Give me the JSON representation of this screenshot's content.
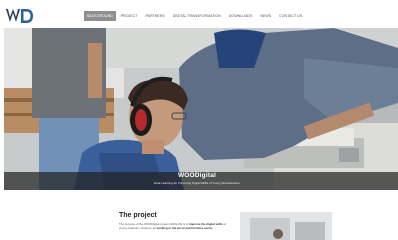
{
  "brand": {
    "logo_text": "WD",
    "logo_tagline": "WOODigital"
  },
  "nav": {
    "items": [
      {
        "label": "Background",
        "active": true
      },
      {
        "label": "Project",
        "active": false
      },
      {
        "label": "Partners",
        "active": false
      },
      {
        "label": "Digital Transformation",
        "active": false
      },
      {
        "label": "Downloads",
        "active": false
      },
      {
        "label": "News",
        "active": false
      },
      {
        "label": "Contact us",
        "active": false
      }
    ]
  },
  "hero": {
    "title": "WOODigital",
    "subtitle": "Dual Learning for Improving Digital Skills of Young Woodworkers"
  },
  "project": {
    "heading": "The project",
    "paragraph_start": "The purpose of the WOODigital project (2019-22) is to ",
    "paragraph_bold": "improve the digital skills",
    "paragraph_mid": " of young students / workers, as ",
    "paragraph_bold2": "working in the wood and furniture sector",
    "paragraph_end": " ..."
  },
  "colors": {
    "accent": "#8f8f8f",
    "logo_blue": "#2b5f9e",
    "hero_band": "#232323"
  }
}
